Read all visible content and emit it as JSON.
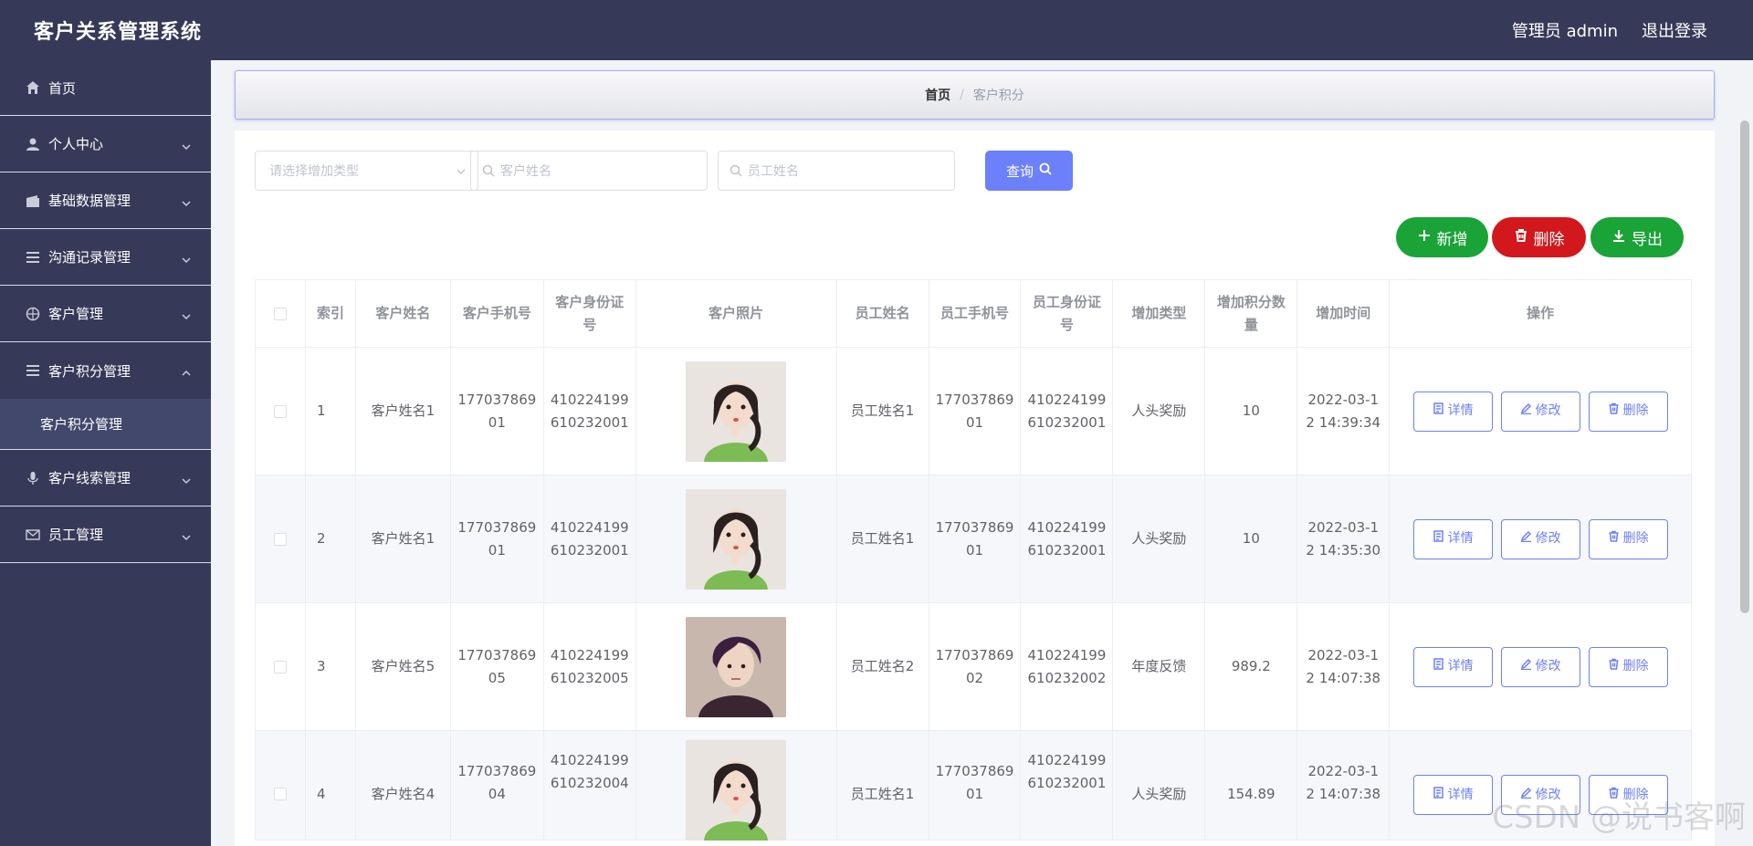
{
  "header": {
    "title": "客户关系管理系统",
    "user_label": "管理员 admin",
    "logout_label": "退出登录"
  },
  "sidebar": {
    "items": [
      {
        "label": "首页",
        "icon": "home-icon",
        "has_children": false
      },
      {
        "label": "个人中心",
        "icon": "user-icon",
        "has_children": true
      },
      {
        "label": "基础数据管理",
        "icon": "wallet-icon",
        "has_children": true
      },
      {
        "label": "沟通记录管理",
        "icon": "list-icon",
        "has_children": true
      },
      {
        "label": "客户管理",
        "icon": "compass-icon",
        "has_children": true
      },
      {
        "label": "客户积分管理",
        "icon": "list-icon",
        "has_children": true,
        "expanded": true,
        "children": [
          "客户积分管理"
        ]
      },
      {
        "label": "客户线索管理",
        "icon": "microphone-icon",
        "has_children": true
      },
      {
        "label": "员工管理",
        "icon": "mail-icon",
        "has_children": true
      }
    ]
  },
  "breadcrumb": {
    "home": "首页",
    "current": "客户积分"
  },
  "search": {
    "type_placeholder": "请选择增加类型",
    "customer_placeholder": "客户姓名",
    "employee_placeholder": "员工姓名",
    "query_label": "查询"
  },
  "actions": {
    "add": "新增",
    "delete": "删除",
    "export": "导出"
  },
  "table": {
    "headers": [
      "索引",
      "客户姓名",
      "客户手机号",
      "客户身份证号",
      "客户照片",
      "员工姓名",
      "员工手机号",
      "员工身份证号",
      "增加类型",
      "增加积分数量",
      "增加时间",
      "操作"
    ],
    "row_actions": {
      "detail": "详情",
      "edit": "修改",
      "delete": "删除"
    },
    "rows": [
      {
        "index": "1",
        "customer": "客户姓名1",
        "phone": "17703786901",
        "id_card": "410224199610232001",
        "photo": "female-avatar",
        "employee": "员工姓名1",
        "emp_phone": "17703786901",
        "emp_id": "410224199610232001",
        "type": "人头奖励",
        "points": "10",
        "time": "2022-03-12 14:39:34"
      },
      {
        "index": "2",
        "customer": "客户姓名1",
        "phone": "17703786901",
        "id_card": "410224199610232001",
        "photo": "female-avatar",
        "employee": "员工姓名1",
        "emp_phone": "17703786901",
        "emp_id": "410224199610232001",
        "type": "人头奖励",
        "points": "10",
        "time": "2022-03-12 14:35:30"
      },
      {
        "index": "3",
        "customer": "客户姓名5",
        "phone": "17703786905",
        "id_card": "410224199610232005",
        "photo": "male-avatar",
        "employee": "员工姓名2",
        "emp_phone": "17703786902",
        "emp_id": "410224199610232002",
        "type": "年度反馈",
        "points": "989.2",
        "time": "2022-03-12 14:07:38"
      },
      {
        "index": "4",
        "customer": "客户姓名4",
        "phone": "17703786904",
        "id_card": "410224199610232004",
        "photo": "female-avatar",
        "employee": "员工姓名1",
        "emp_phone": "17703786901",
        "emp_id": "410224199610232001",
        "type": "人头奖励",
        "points": "154.89",
        "time": "2022-03-12 14:07:38"
      }
    ]
  },
  "watermark": "CSDN @说书客啊",
  "colors": {
    "sidebar_bg": "#363a58",
    "accent": "#6c80f9",
    "success": "#1aa337",
    "danger": "#d2181c"
  }
}
